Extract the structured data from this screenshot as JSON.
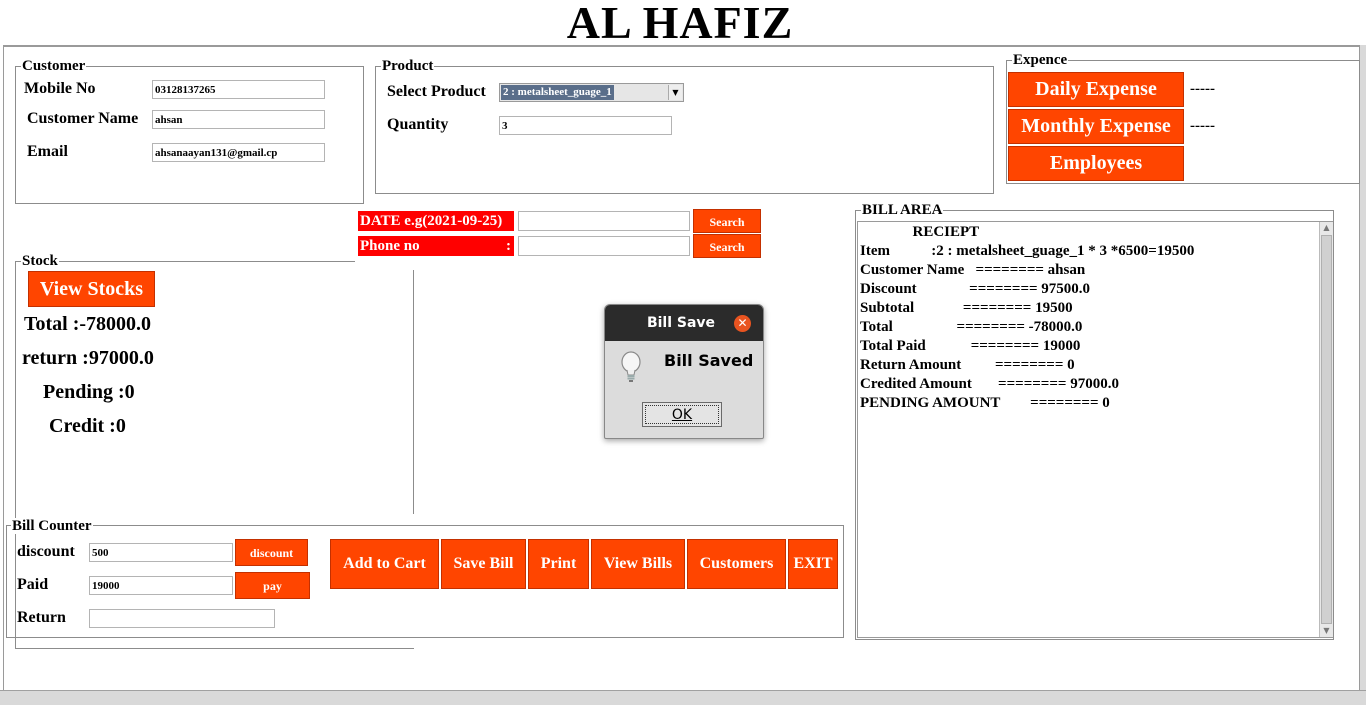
{
  "app_title": "AL HAFIZ",
  "colors": {
    "accent": "#ff4500",
    "label_red": "#ff0000",
    "dialog_header": "#2b2b2b",
    "close": "#e95420"
  },
  "customer": {
    "legend": "Customer",
    "mobile_label": "Mobile No",
    "mobile_value": "03128137265",
    "name_label": "Customer Name",
    "name_value": "ahsan",
    "email_label": "Email",
    "email_value": "ahsanaayan131@gmail.cp"
  },
  "product": {
    "legend": "Product",
    "select_label": "Select Product",
    "select_value": "2 : metalsheet_guage_1",
    "qty_label": "Quantity",
    "qty_value": "3"
  },
  "expense": {
    "legend": "Expence",
    "daily_label": "Daily Expense",
    "daily_value": "-----",
    "monthly_label": "Monthly Expense",
    "monthly_value": "-----",
    "employees_label": "Employees"
  },
  "search": {
    "date_label": "DATE e.g(2021-09-25)",
    "date_value": "",
    "date_button": "Search",
    "phone_label": "Phone no",
    "phone_colon": ":",
    "phone_value": "",
    "phone_button": "Search"
  },
  "stock": {
    "legend": "Stock",
    "view_button": "View Stocks",
    "total": "Total :-78000.0",
    "return": "return :97000.0",
    "pending": "Pending :0",
    "credit": "Credit  :0"
  },
  "bill_counter": {
    "legend": "Bill Counter",
    "discount_label": "discount",
    "discount_value": "500",
    "discount_button": "discount",
    "paid_label": "Paid",
    "paid_value": "19000",
    "pay_button": "pay",
    "return_label": "Return",
    "return_value": ""
  },
  "actions": [
    "Add to Cart",
    "Save Bill",
    "Print",
    "View Bills",
    "Customers",
    "EXIT"
  ],
  "bill_area": {
    "legend": "BILL AREA",
    "lines": [
      "              RECIEPT",
      "Item           :2 : metalsheet_guage_1 * 3 *6500=19500",
      "Customer Name   ======== ahsan",
      "Discount              ======== 97500.0",
      "Subtotal             ======== 19500",
      "Total                 ======== -78000.0",
      "Total Paid            ======== 19000",
      "Return Amount         ======== 0",
      "Credited Amount       ======== 97000.0",
      "PENDING AMOUNT        ======== 0"
    ]
  },
  "dialog": {
    "title": "Bill Save",
    "message": "Bill Saved",
    "ok": "OK",
    "icon": "lightbulb-icon"
  }
}
